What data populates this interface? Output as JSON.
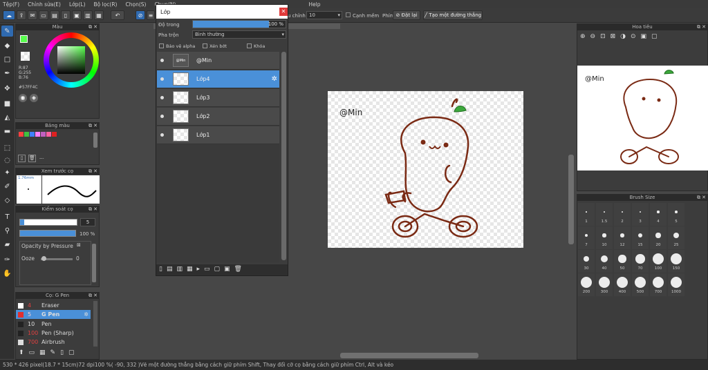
{
  "menu": [
    "Tệp(F)",
    "Chỉnh sửa(E)",
    "Lớp(L)",
    "Bộ lọc(R)",
    "Chọn(S)",
    "Chụp(N)",
    "",
    "",
    "",
    "",
    "Help"
  ],
  "toolbar": {
    "correction_label": "u chỉnh",
    "correction_value": "10",
    "smooth_label": "Cạnh mềm",
    "key_label": "Phím",
    "cancel_label": "Đặt lại",
    "line_label": "Tạo một đường thẳng"
  },
  "color_panel": {
    "title": "Màu",
    "r": "R:87",
    "g": "G:255",
    "b": "B:76",
    "hex": "#57FF4C",
    "fg": "#57ff4c"
  },
  "palette_panel": {
    "title": "Bảng màu",
    "colors": [
      "#ff4040",
      "#40c040",
      "#4080ff",
      "#ff80ff",
      "#c060c0",
      "#ff60a0",
      "#e02020"
    ],
    "footer": "---"
  },
  "preview_panel": {
    "title": "Xem trước cọ",
    "size": "1.76mm"
  },
  "brush_control": {
    "title": "Kiểm soát cọ",
    "size_value": "5",
    "opacity_value": "100 %",
    "opacity_pressure_label": "Opacity by Pressure",
    "ooze_label": "Ooze",
    "ooze_value": "0"
  },
  "brush_list": {
    "title": "Cọ: G Pen",
    "items": [
      {
        "size": "4",
        "name": "Eraser",
        "color": "#ffffff"
      },
      {
        "size": "5",
        "name": "G Pen",
        "color": "#e03030"
      },
      {
        "size": "10",
        "name": "Pen",
        "color": "#ffffff"
      },
      {
        "size": "100",
        "name": "Pen (Sharp)",
        "color": "#ffffff"
      },
      {
        "size": "700",
        "name": "Airbrush",
        "color": "#ffffff"
      }
    ]
  },
  "layer_panel": {
    "title": "Lớp",
    "opacity_label": "Độ trong",
    "opacity_value": "100 %",
    "blend_label": "Pha trộn",
    "blend_value": "Bình thường",
    "protect_alpha": "Bảo vệ alpha",
    "clipping": "Xén bớt",
    "lock": "Khóa",
    "layers": [
      "@Min",
      "Lớp4",
      "Lớp3",
      "Lớp2",
      "Lớp1"
    ],
    "thumb_text": "@Min"
  },
  "canvas": {
    "text": "@Min"
  },
  "navigator": {
    "title": "Hoa tiêu",
    "text": "@Min"
  },
  "brush_size": {
    "title": "Brush Size",
    "sizes": [
      "1",
      "1.5",
      "2",
      "3",
      "4",
      "5",
      "7",
      "10",
      "12",
      "15",
      "20",
      "25",
      "30",
      "40",
      "50",
      "70",
      "100",
      "150",
      "200",
      "300",
      "400",
      "500",
      "700",
      "1000"
    ]
  },
  "status": {
    "size": "530 * 426 pixel",
    "cm": "(18.7 * 15cm)",
    "dpi": "72 dpi",
    "zoom": "100 %",
    "coords": "( -90, 332 )",
    "hint": "Vẽ một đường thẳng bằng cách giữ phím Shift, Thay đổi cỡ cọ bằng cách giữ phím Ctrl, Alt và kéo"
  }
}
